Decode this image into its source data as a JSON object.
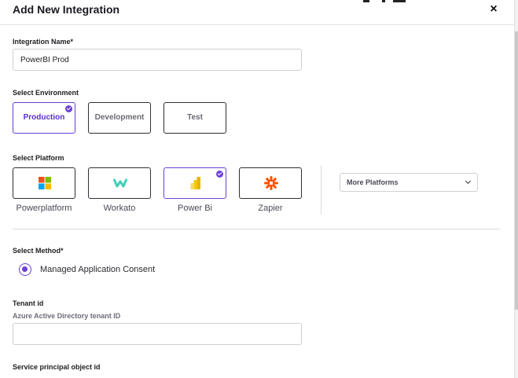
{
  "dialog": {
    "title": "Add New Integration",
    "close_glyph": "×"
  },
  "integration_name": {
    "label": "Integration Name*",
    "value": "PowerBI Prod"
  },
  "environment": {
    "label": "Select Environment",
    "options": [
      "Production",
      "Development",
      "Test"
    ],
    "selected": "Production"
  },
  "platform": {
    "label": "Select Platform",
    "options": [
      {
        "label": "Powerplatform",
        "icon": "microsoft-grid-icon"
      },
      {
        "label": "Workato",
        "icon": "workato-icon"
      },
      {
        "label": "Power Bi",
        "icon": "power-bi-icon"
      },
      {
        "label": "Zapier",
        "icon": "zapier-icon"
      }
    ],
    "selected": "Power Bi",
    "more_label": "More Platforms"
  },
  "method": {
    "label": "Select Method*",
    "option": "Managed Application Consent"
  },
  "tenant": {
    "label": "Tenant id",
    "sublabel": "Azure Active Directory tenant ID",
    "value": ""
  },
  "service_principal": {
    "label": "Service principal object id"
  },
  "colors": {
    "accent": "#6b3fd6",
    "powerbi_yellow": "#f2c811",
    "zapier_orange": "#ff4f00",
    "workato_teal": "#3fd1b5",
    "ms_red": "#f25022",
    "ms_green": "#7fba00",
    "ms_blue": "#00a4ef",
    "ms_yellow": "#ffb900"
  }
}
